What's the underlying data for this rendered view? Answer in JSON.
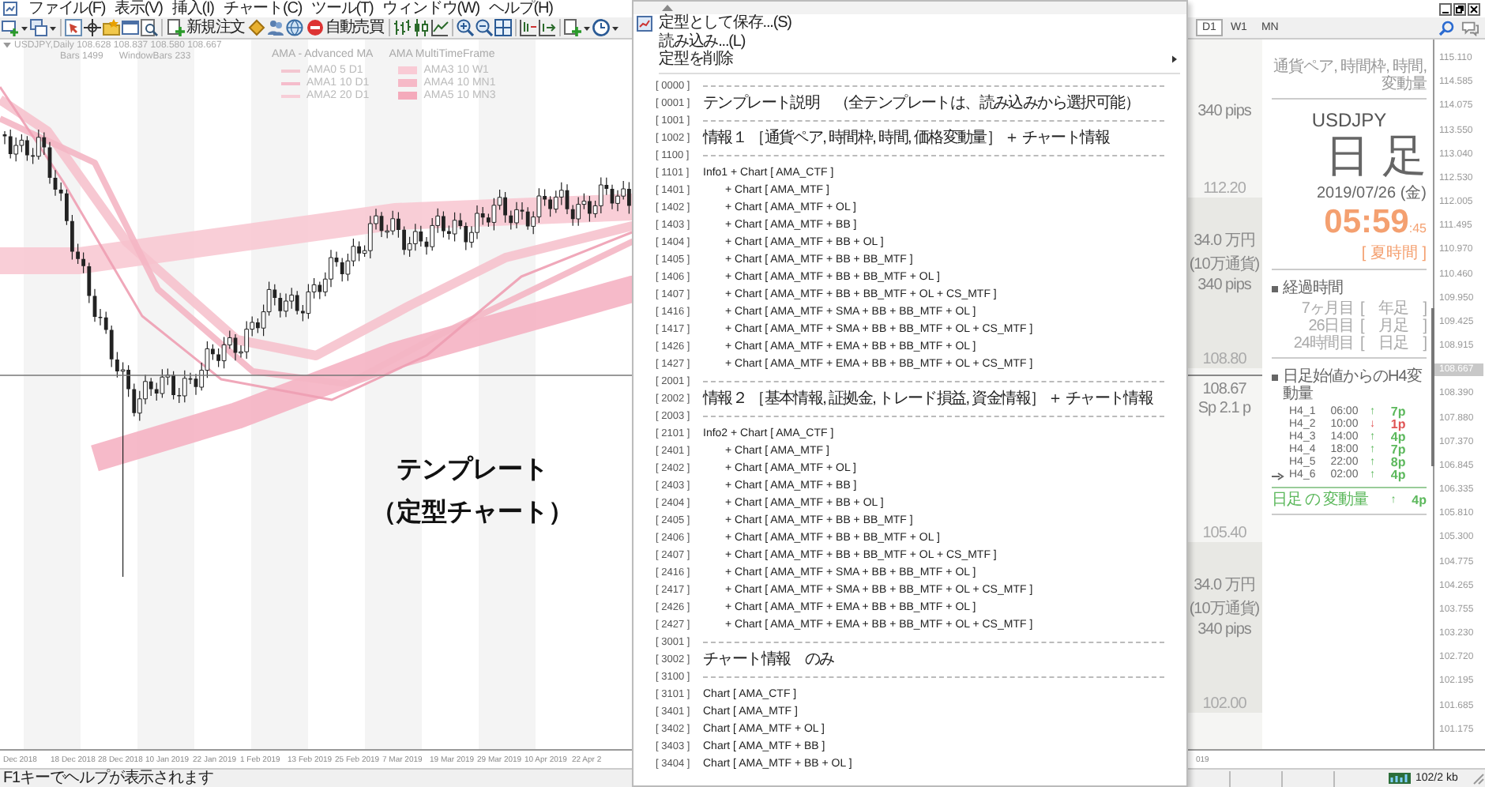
{
  "menu_bar": {
    "items": [
      "ファイル(F)",
      "表示(V)",
      "挿入(I)",
      "チャート(C)",
      "ツール(T)",
      "ウィンドウ(W)",
      "ヘルプ(H)"
    ]
  },
  "toolbar": {
    "buttons": [
      {
        "label": "新規注文"
      },
      {
        "label": "自動売買"
      }
    ]
  },
  "chart_tabs": [
    {
      "label": "D1",
      "selected": true
    },
    {
      "label": "W1",
      "selected": false
    },
    {
      "label": "MN",
      "selected": false
    }
  ],
  "chart": {
    "title": "USDJPY,Daily 108.628 108.837 108.580 108.667",
    "bars": "Bars 1499",
    "window_bars": "WindowBars 233",
    "legends": [
      {
        "title": "AMA - Advanced MA",
        "kind": "line",
        "items": [
          {
            "label": "AMA0 5 D1",
            "color": "#f3c6d0"
          },
          {
            "label": "AMA1 10 D1",
            "color": "#f5bccb"
          },
          {
            "label": "AMA2 20 D1",
            "color": "#f7cdd7"
          }
        ]
      },
      {
        "title": "AMA MultiTimeFrame",
        "kind": "band",
        "items": [
          {
            "label": "AMA3 10 W1",
            "color": "#f9cbd5"
          },
          {
            "label": "AMA4 10 MN1",
            "color": "#f6b9c7"
          },
          {
            "label": "AMA5 10 MN3",
            "color": "#f4aabb"
          }
        ]
      }
    ],
    "overlay": [
      "テンプレート",
      "（定型チャート）"
    ],
    "dates": [
      "Dec 2018",
      "18 Dec 2018",
      "28 Dec 2018",
      "10 Jan 2019",
      "22 Jan 2019",
      "1 Feb 2019",
      "13 Feb 2019",
      "25 Feb 2019",
      "7 Mar 2019",
      "19 Mar 2019",
      "29 Mar 2019",
      "10 Apr 2019",
      "22 Apr 2"
    ]
  },
  "context_menu": {
    "actions": [
      {
        "label": "定型として保存...(S)",
        "kind": "save"
      },
      {
        "label": "読み込み...(L)",
        "kind": "plain"
      },
      {
        "label": "定型を削除",
        "kind": "submenu"
      }
    ],
    "templates": [
      {
        "code": "[ 0000 ]",
        "kind": "separator"
      },
      {
        "code": "[ 0001 ]",
        "kind": "title",
        "label": "テンプレート説明　（全テンプレートは、読み込みから選択可能）"
      },
      {
        "code": "[ 1001 ]",
        "kind": "separator"
      },
      {
        "code": "[ 1002 ]",
        "kind": "title",
        "label": "情報１ ［通貨ペア, 時間枠, 時間, 価格変動量］ ＋ チャート情報"
      },
      {
        "code": "[ 1100 ]",
        "kind": "separator"
      },
      {
        "code": "[ 1101 ]",
        "kind": "group",
        "label": "Info1 + Chart [ AMA_CTF ]"
      },
      {
        "code": "[ 1401 ]",
        "kind": "sub",
        "label": "+ Chart [ AMA_MTF ]"
      },
      {
        "code": "[ 1402 ]",
        "kind": "sub",
        "label": "+ Chart [ AMA_MTF + OL ]"
      },
      {
        "code": "[ 1403 ]",
        "kind": "sub",
        "label": "+ Chart [ AMA_MTF + BB ]"
      },
      {
        "code": "[ 1404 ]",
        "kind": "sub",
        "label": "+ Chart [ AMA_MTF + BB + OL ]"
      },
      {
        "code": "[ 1405 ]",
        "kind": "sub",
        "label": "+ Chart [ AMA_MTF + BB + BB_MTF ]"
      },
      {
        "code": "[ 1406 ]",
        "kind": "sub",
        "label": "+ Chart [ AMA_MTF + BB + BB_MTF + OL ]"
      },
      {
        "code": "[ 1407 ]",
        "kind": "sub",
        "label": "+ Chart [ AMA_MTF + BB + BB_MTF + OL + CS_MTF ]"
      },
      {
        "code": "[ 1416 ]",
        "kind": "sub",
        "label": "+ Chart [ AMA_MTF + SMA + BB + BB_MTF + OL ]"
      },
      {
        "code": "[ 1417 ]",
        "kind": "sub",
        "label": "+ Chart [ AMA_MTF + SMA + BB + BB_MTF + OL + CS_MTF ]"
      },
      {
        "code": "[ 1426 ]",
        "kind": "sub",
        "label": "+ Chart [ AMA_MTF + EMA + BB + BB_MTF + OL ]"
      },
      {
        "code": "[ 1427 ]",
        "kind": "sub",
        "label": "+ Chart [ AMA_MTF + EMA + BB + BB_MTF + OL + CS_MTF ]"
      },
      {
        "code": "[ 2001 ]",
        "kind": "separator"
      },
      {
        "code": "[ 2002 ]",
        "kind": "title",
        "label": "情報２ ［基本情報, 証拠金, トレード損益, 資金情報］ ＋ チャート情報"
      },
      {
        "code": "[ 2003 ]",
        "kind": "separator"
      },
      {
        "code": "[ 2101 ]",
        "kind": "group",
        "label": "Info2 + Chart [ AMA_CTF ]"
      },
      {
        "code": "[ 2401 ]",
        "kind": "sub",
        "label": "+ Chart [ AMA_MTF ]"
      },
      {
        "code": "[ 2402 ]",
        "kind": "sub",
        "label": "+ Chart [ AMA_MTF + OL ]"
      },
      {
        "code": "[ 2403 ]",
        "kind": "sub",
        "label": "+ Chart [ AMA_MTF + BB ]"
      },
      {
        "code": "[ 2404 ]",
        "kind": "sub",
        "label": "+ Chart [ AMA_MTF + BB + OL ]"
      },
      {
        "code": "[ 2405 ]",
        "kind": "sub",
        "label": "+ Chart [ AMA_MTF + BB + BB_MTF ]"
      },
      {
        "code": "[ 2406 ]",
        "kind": "sub",
        "label": "+ Chart [ AMA_MTF + BB + BB_MTF + OL ]"
      },
      {
        "code": "[ 2407 ]",
        "kind": "sub",
        "label": "+ Chart [ AMA_MTF + BB + BB_MTF + OL + CS_MTF ]"
      },
      {
        "code": "[ 2416 ]",
        "kind": "sub",
        "label": "+ Chart [ AMA_MTF + SMA + BB + BB_MTF + OL ]"
      },
      {
        "code": "[ 2417 ]",
        "kind": "sub",
        "label": "+ Chart [ AMA_MTF + SMA + BB + BB_MTF + OL + CS_MTF ]"
      },
      {
        "code": "[ 2426 ]",
        "kind": "sub",
        "label": "+ Chart [ AMA_MTF + EMA + BB + BB_MTF + OL ]"
      },
      {
        "code": "[ 2427 ]",
        "kind": "sub",
        "label": "+ Chart [ AMA_MTF + EMA + BB + BB_MTF + OL + CS_MTF ]"
      },
      {
        "code": "[ 3001 ]",
        "kind": "separator"
      },
      {
        "code": "[ 3002 ]",
        "kind": "title",
        "label": "チャート情報　のみ"
      },
      {
        "code": "[ 3100 ]",
        "kind": "separator"
      },
      {
        "code": "[ 3101 ]",
        "kind": "group",
        "label": "Chart [ AMA_CTF ]"
      },
      {
        "code": "[ 3401 ]",
        "kind": "group",
        "label": "Chart [ AMA_MTF ]"
      },
      {
        "code": "[ 3402 ]",
        "kind": "group",
        "label": "Chart [ AMA_MTF + OL ]"
      },
      {
        "code": "[ 3403 ]",
        "kind": "group",
        "label": "Chart [ AMA_MTF + BB ]"
      },
      {
        "code": "[ 3404 ]",
        "kind": "group",
        "label": "Chart [ AMA_MTF + BB + OL ]"
      }
    ]
  },
  "level_column": {
    "zones": [
      {
        "kind": "light",
        "texts": [
          "340 pips",
          "112.20"
        ]
      },
      {
        "kind": "dark",
        "texts": [
          "34.0 万円",
          "(10万通貨)",
          "340 pips",
          "108.80"
        ]
      },
      {
        "kind": "light",
        "texts": [
          "108.67",
          "Sp 2.1 p",
          "105.40"
        ]
      },
      {
        "kind": "dark",
        "texts": [
          "34.0 万円",
          "(10万通貨)",
          "340 pips",
          "102.00"
        ]
      }
    ]
  },
  "info_panel": {
    "caption": "通貨ペア, 時間枠, 時間, 変動量",
    "symbol": "USDJPY",
    "timeframe": "日 足",
    "date": "2019/07/26 (金)",
    "time": "05:59",
    "seconds": ":45",
    "dst": "[ 夏時間 ]",
    "elapsed": {
      "heading": "経過時間",
      "rows": [
        {
          "count": "7ヶ月目",
          "bracket": "[　年足　]"
        },
        {
          "count": "26日目",
          "bracket": "[　月足　]"
        },
        {
          "count": "24時間目",
          "bracket": "[　日足　]"
        }
      ]
    },
    "moves": {
      "heading": "日足始値からのH4変動量",
      "rows": [
        {
          "bar": "H4_1",
          "time": "06:00",
          "arrow": "↑",
          "value": "7p",
          "color": "#5cb85c",
          "current": false
        },
        {
          "bar": "H4_2",
          "time": "10:00",
          "arrow": "↓",
          "value": "1p",
          "color": "#e05555",
          "current": false
        },
        {
          "bar": "H4_3",
          "time": "14:00",
          "arrow": "↑",
          "value": "4p",
          "color": "#5cb85c",
          "current": false
        },
        {
          "bar": "H4_4",
          "time": "18:00",
          "arrow": "↑",
          "value": "7p",
          "color": "#5cb85c",
          "current": false
        },
        {
          "bar": "H4_5",
          "time": "22:00",
          "arrow": "↑",
          "value": "8p",
          "color": "#5cb85c",
          "current": false
        },
        {
          "bar": "H4_6",
          "time": "02:00",
          "arrow": "↑",
          "value": "4p",
          "color": "#5cb85c",
          "current": true
        }
      ],
      "total": {
        "label": "日足 の 変動量",
        "arrow": "↑",
        "value": "4p",
        "color": "#5cb85c"
      }
    }
  },
  "price_axis": [
    {
      "label": "115.110",
      "kind": "tick"
    },
    {
      "label": "114.585",
      "kind": "tick"
    },
    {
      "label": "114.075",
      "kind": "tick"
    },
    {
      "label": "113.550",
      "kind": "tick"
    },
    {
      "label": "113.040",
      "kind": "tick"
    },
    {
      "label": "112.530",
      "kind": "tick"
    },
    {
      "label": "112.005",
      "kind": "tick"
    },
    {
      "label": "111.495",
      "kind": "tick"
    },
    {
      "label": "110.970",
      "kind": "tick"
    },
    {
      "label": "110.460",
      "kind": "tick"
    },
    {
      "label": "109.950",
      "kind": "tick"
    },
    {
      "label": "109.425",
      "kind": "tick"
    },
    {
      "label": "108.915",
      "kind": "tick"
    },
    {
      "label": "108.667",
      "kind": "current"
    },
    {
      "label": "108.390",
      "kind": "tick"
    },
    {
      "label": "107.880",
      "kind": "tick"
    },
    {
      "label": "107.370",
      "kind": "tick"
    },
    {
      "label": "106.845",
      "kind": "tick"
    },
    {
      "label": "106.335",
      "kind": "tick"
    },
    {
      "label": "105.810",
      "kind": "tick"
    },
    {
      "label": "105.300",
      "kind": "tick"
    },
    {
      "label": "104.775",
      "kind": "tick"
    },
    {
      "label": "104.265",
      "kind": "tick"
    },
    {
      "label": "103.755",
      "kind": "tick"
    },
    {
      "label": "103.230",
      "kind": "tick"
    },
    {
      "label": "102.720",
      "kind": "tick"
    },
    {
      "label": "102.195",
      "kind": "tick"
    },
    {
      "label": "101.685",
      "kind": "tick"
    },
    {
      "label": "101.175",
      "kind": "tick"
    }
  ],
  "chart2_dates": [
    "019"
  ],
  "status_bar": {
    "help": "F1キーでヘルプが表示されます",
    "traffic": "102/2 kb"
  }
}
